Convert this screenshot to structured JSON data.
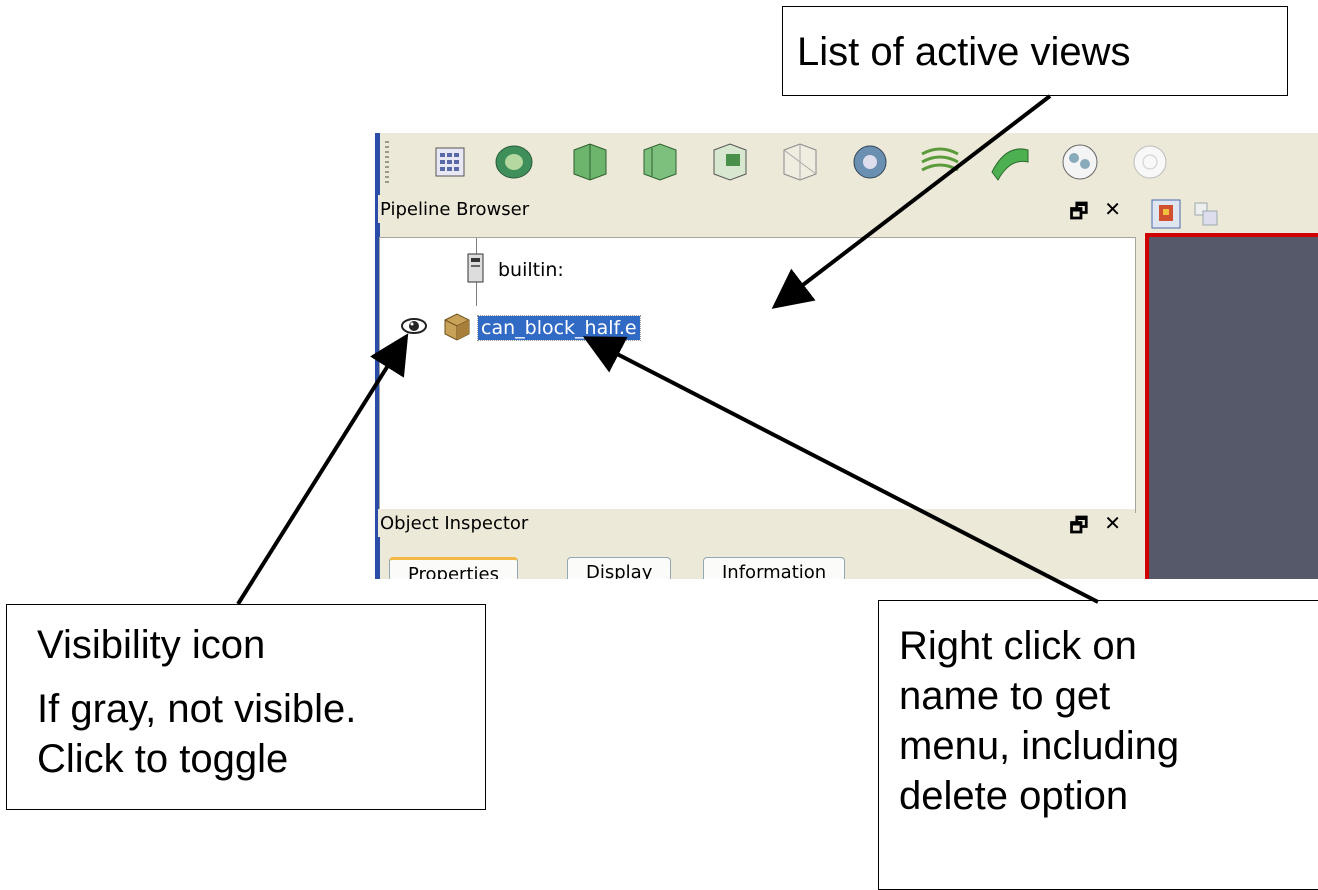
{
  "annotations": {
    "active_views": "List of active views",
    "visibility_line1": "Visibility icon",
    "visibility_line2": "If gray, not visible.",
    "visibility_line3": "Click to toggle",
    "rightclick_line1": "Right click on",
    "rightclick_line2": "name to get",
    "rightclick_line3": "menu, including",
    "rightclick_line4": "delete option"
  },
  "pipeline_browser": {
    "title": "Pipeline Browser",
    "items": [
      {
        "label": "builtin:",
        "icon": "server-icon"
      },
      {
        "label": "can_block_half.e",
        "icon": "dataset-cube-icon",
        "selected": true,
        "visible": true
      }
    ]
  },
  "object_inspector": {
    "title": "Object Inspector",
    "tabs": [
      "Properties",
      "Display",
      "Information"
    ],
    "active_tab": "Properties"
  },
  "dock_controls": {
    "float": "🗗",
    "close": "✕"
  },
  "colors": {
    "selection": "#316ac5",
    "render_bg": "#56596a",
    "render_border": "#d00000"
  }
}
